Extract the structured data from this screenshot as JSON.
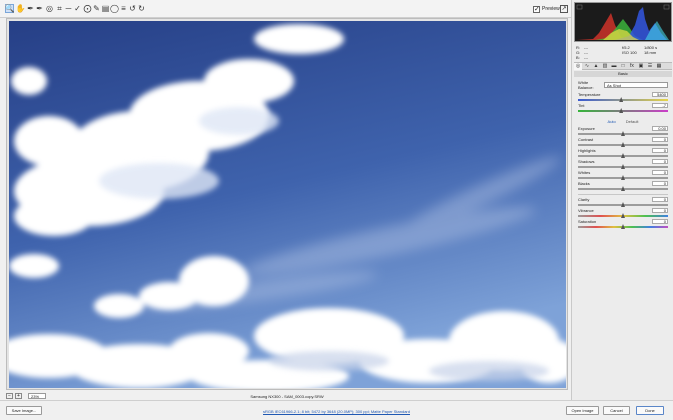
{
  "toolbar": {
    "tools": [
      "zoom-icon",
      "hand-icon",
      "eyedropper-icon",
      "color-sampler-icon",
      "target-adjust-icon",
      "crop-icon",
      "straighten-icon",
      "spot-removal-icon",
      "red-eye-icon",
      "adjustment-brush-icon",
      "graduated-filter-icon",
      "radial-filter-icon",
      "preferences-icon",
      "rotate-left-icon",
      "rotate-right-icon"
    ],
    "preview_label": "Preview"
  },
  "rgb": {
    "r_label": "R:",
    "r_value": "---",
    "g_label": "G:",
    "g_value": "---",
    "b_label": "B:",
    "b_value": "---"
  },
  "exif": {
    "aperture": "f/5.2",
    "shutter": "1/800 s",
    "iso": "ISO 100",
    "focal": "18 mm"
  },
  "panel": {
    "header": "Basic",
    "white_balance_label": "White Balance:",
    "white_balance_value": "As Shot",
    "temperature_label": "Temperature",
    "temperature_value": "5400",
    "tint_label": "Tint",
    "tint_value": "-7",
    "auto_label": "Auto",
    "default_label": "Default",
    "exposure_label": "Exposure",
    "exposure_value": "0.00",
    "contrast_label": "Contrast",
    "contrast_value": "0",
    "highlights_label": "Highlights",
    "highlights_value": "0",
    "shadows_label": "Shadows",
    "shadows_value": "0",
    "whites_label": "Whites",
    "whites_value": "0",
    "blacks_label": "Blacks",
    "blacks_value": "0",
    "clarity_label": "Clarity",
    "clarity_value": "0",
    "vibrance_label": "Vibrance",
    "vibrance_value": "0",
    "saturation_label": "Saturation",
    "saturation_value": "0"
  },
  "slider_levels": {
    "temperature": 0.48,
    "tint": 0.48,
    "exposure": 0.5,
    "contrast": 0.5,
    "highlights": 0.5,
    "shadows": 0.5,
    "whites": 0.5,
    "blacks": 0.5,
    "clarity": 0.5,
    "vibrance": 0.5,
    "saturation": 0.5
  },
  "status": {
    "zoom_value": "23%",
    "filename": "Samsung NX300 - SAM_0003.copy.SRW"
  },
  "bottom": {
    "save_label": "Save Image...",
    "workflow_link": "sRGB IEC61966-2.1; 8 bit; 5472 by 3648 (20.0MP); 300 ppi; Matte Paper Standard",
    "open_label": "Open Image",
    "cancel_label": "Cancel",
    "done_label": "Done"
  },
  "colors": {
    "accent": "#1f58b3",
    "sky_top": "#2d4e95",
    "sky_bottom": "#6d93cf"
  }
}
